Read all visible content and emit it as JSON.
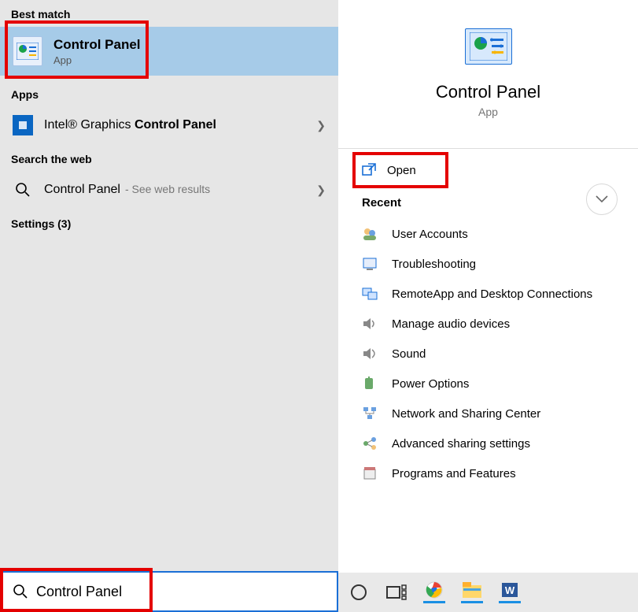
{
  "left": {
    "best_match_header": "Best match",
    "best_match": {
      "title": "Control Panel",
      "subtitle": "App"
    },
    "apps_header": "Apps",
    "apps": [
      {
        "prefix": "Intel® Graphics ",
        "bold": "Control Panel"
      }
    ],
    "web_header": "Search the web",
    "web": {
      "query": "Control Panel",
      "suffix": "- See web results"
    },
    "settings_header": "Settings (3)",
    "search_value": "Control Panel"
  },
  "right": {
    "hero_title": "Control Panel",
    "hero_sub": "App",
    "open_label": "Open",
    "recent_header": "Recent",
    "recent": [
      "User Accounts",
      "Troubleshooting",
      "RemoteApp and Desktop Connections",
      "Manage audio devices",
      "Sound",
      "Power Options",
      "Network and Sharing Center",
      "Advanced sharing settings",
      "Programs and Features"
    ]
  },
  "taskbar": {
    "items": [
      "cortana-icon",
      "task-view-icon",
      "chrome-icon",
      "explorer-icon",
      "word-icon"
    ]
  }
}
